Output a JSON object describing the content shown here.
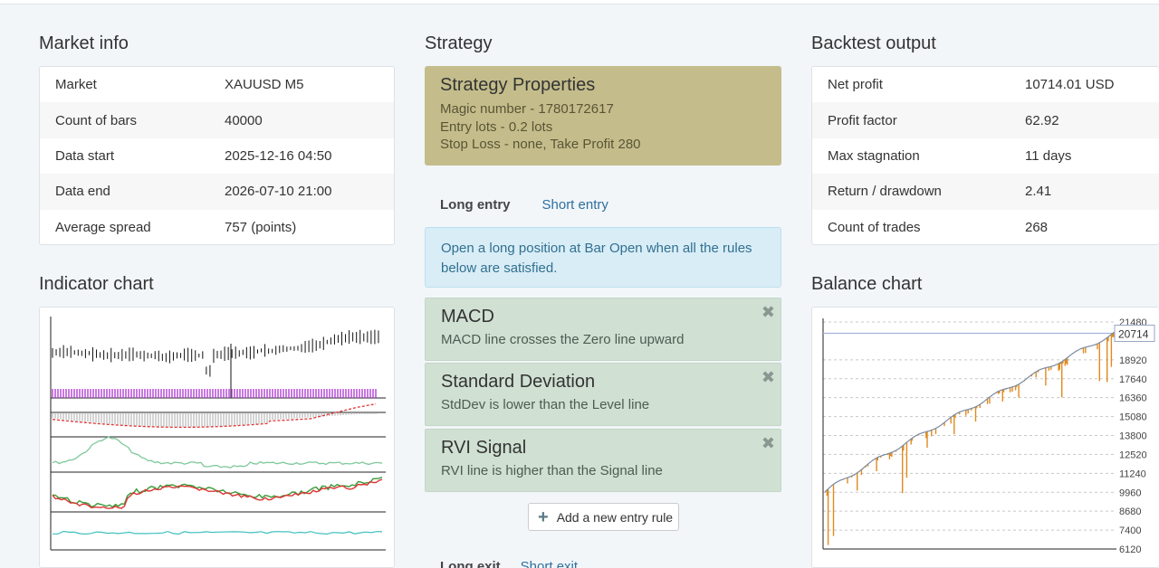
{
  "market_info": {
    "title": "Market info",
    "rows": [
      {
        "label": "Market",
        "value": "XAUUSD M5"
      },
      {
        "label": "Count of bars",
        "value": "40000"
      },
      {
        "label": "Data start",
        "value": "2025-12-16 04:50"
      },
      {
        "label": "Data end",
        "value": "2026-07-10 21:00"
      },
      {
        "label": "Average spread",
        "value": "757 (points)"
      }
    ]
  },
  "indicator_chart": {
    "title": "Indicator chart"
  },
  "strategy": {
    "title": "Strategy",
    "properties": {
      "title": "Strategy Properties",
      "magic": "Magic number - 1780172617",
      "lots": "Entry lots - 0.2 lots",
      "sl_tp": "Stop Loss - none, Take Profit 280"
    },
    "tabs": {
      "long": "Long entry",
      "short": "Short entry"
    },
    "info": "Open a long position at Bar Open when all the rules below are satisfied.",
    "rules": [
      {
        "title": "MACD",
        "desc": "MACD line crosses the Zero line upward"
      },
      {
        "title": "Standard Deviation",
        "desc": "StdDev is lower than the Level line"
      },
      {
        "title": "RVI Signal",
        "desc": "RVI line is higher than the Signal line"
      }
    ],
    "remove_glyph": "✖",
    "add_rule": "Add a new entry rule",
    "exit_tabs": {
      "long": "Long exit",
      "short": "Short exit"
    }
  },
  "backtest": {
    "title": "Backtest output",
    "rows": [
      {
        "label": "Net profit",
        "value": "10714.01 USD"
      },
      {
        "label": "Profit factor",
        "value": "62.92"
      },
      {
        "label": "Max stagnation",
        "value": "11 days"
      },
      {
        "label": "Return / drawdown",
        "value": "2.41"
      },
      {
        "label": "Count of trades",
        "value": "268"
      }
    ]
  },
  "balance_chart": {
    "title": "Balance chart",
    "current_label": "20714"
  },
  "chart_data": {
    "type": "line",
    "yticks": [
      21480,
      18920,
      17640,
      16360,
      15080,
      13800,
      12520,
      11240,
      9960,
      8680,
      7400,
      6120
    ],
    "ylim": [
      6120,
      21480
    ],
    "current": 20714,
    "colors": {
      "balance": "#7b8aa0",
      "equity": "#e08a1e",
      "marker": "#a8b4d8"
    }
  }
}
